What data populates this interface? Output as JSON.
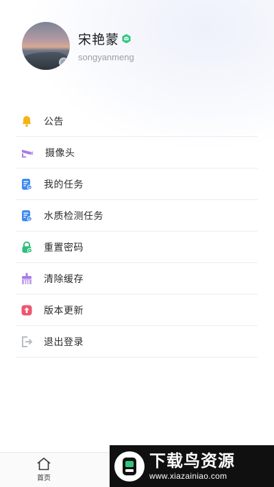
{
  "profile": {
    "name": "宋艳蒙",
    "username": "songyanmeng"
  },
  "menu": {
    "items": [
      {
        "label": "公告",
        "icon": "bell-icon",
        "color": "#f5b316"
      },
      {
        "label": "摄像头",
        "icon": "camera-icon",
        "color": "#a77ce6"
      },
      {
        "label": "我的任务",
        "icon": "task-doc-icon",
        "color": "#3f8af0"
      },
      {
        "label": "水质检测任务",
        "icon": "water-task-icon",
        "color": "#3f8af0"
      },
      {
        "label": "重置密码",
        "icon": "lock-icon",
        "color": "#2fbf7a"
      },
      {
        "label": "清除缓存",
        "icon": "broom-icon",
        "color": "#a77ce6"
      },
      {
        "label": "版本更新",
        "icon": "update-icon",
        "color": "#f05570"
      },
      {
        "label": "退出登录",
        "icon": "logout-icon",
        "color": "#b8bcc4"
      }
    ]
  },
  "tabbar": {
    "home_label": "首页"
  },
  "watermark": {
    "title": "下载鸟资源",
    "url": "www.xiazainiao.com"
  },
  "colors": {
    "verify_badge": "#2ec77a",
    "divider": "#ececf0"
  }
}
